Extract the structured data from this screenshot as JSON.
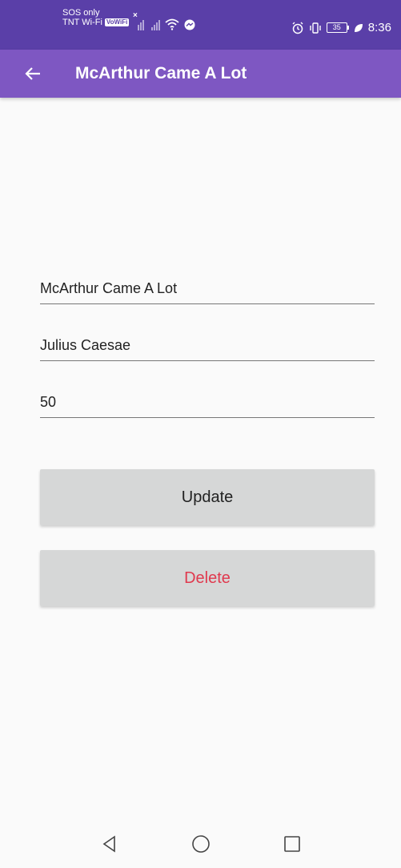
{
  "status": {
    "carrier_top": "SOS only",
    "carrier_bottom": "TNT Wi-Fi",
    "vowifi_badge": "VoWiFi",
    "battery_level": "35",
    "time": "8:36"
  },
  "toolbar": {
    "title": "McArthur Came A Lot",
    "back_icon": "arrow-left-icon"
  },
  "form": {
    "title_value": "McArthur Came A Lot",
    "author_value": "Julius Caesae",
    "number_value": "50"
  },
  "buttons": {
    "update_label": "Update",
    "delete_label": "Delete"
  },
  "colors": {
    "status_bar": "#5a3fa8",
    "toolbar": "#7e57c2",
    "delete_text": "#e0394e",
    "button_bg": "#d6d7d7"
  },
  "nav": {
    "back": "nav-back-icon",
    "home": "nav-home-icon",
    "recents": "nav-recents-icon"
  }
}
